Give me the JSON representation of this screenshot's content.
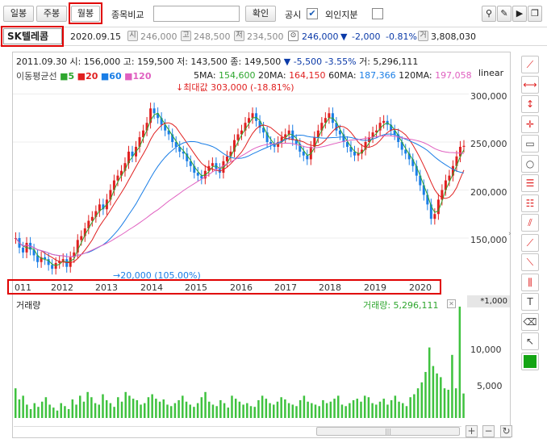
{
  "toolbar": {
    "daily": "일봉",
    "weekly": "주봉",
    "monthly": "월봉",
    "compare_label": "종목비교",
    "compare_value": "",
    "confirm": "확인",
    "notice_label": "공시",
    "foreign_label": "외인지분"
  },
  "stock": {
    "name": "SK텔레콤",
    "date": "2020.09.15",
    "open_icon": "시",
    "open": "246,000",
    "high_icon": "고",
    "high": "248,500",
    "low_icon": "저",
    "low": "234,500",
    "close": "246,000",
    "change_arrow": "▼",
    "change": "-2,000",
    "change_pct": "-0.81%",
    "volume_icon": "거",
    "volume": "3,808,030"
  },
  "info": {
    "line": "2011.09.30 시: 156,000 고: 159,500 저: 143,500 종: 149,500",
    "arrow": "▼",
    "change": "-5,500",
    "pct": "-3.55%",
    "vol": "거: 5,296,111"
  },
  "ma": {
    "title": "이동평균선",
    "p5": "5",
    "p20": "20",
    "p60": "60",
    "p120": "120",
    "v5l": "5MA:",
    "v5": "154,600",
    "v20l": "20MA:",
    "v20": "164,150",
    "v60l": "60MA:",
    "v60": "187,366",
    "v120l": "120MA:",
    "v120": "197,058"
  },
  "scale_mode": "linear",
  "annotations": {
    "max": "최대값 303,000 (-18.81%)",
    "min": "20,000 (105.00%)"
  },
  "chart_data": {
    "type": "candlestick",
    "yticks": [
      "300,000",
      "250,000",
      "200,000",
      "150,000"
    ],
    "years": [
      "011",
      "2012",
      "2013",
      "2014",
      "2015",
      "2016",
      "2017",
      "2018",
      "2019",
      "2020"
    ],
    "volume_label": "거래량",
    "volume_value": "거래량: 5,296,111",
    "volume_unit": "*1,000",
    "volume_ticks": [
      "10,000",
      "5,000"
    ]
  },
  "colors": {
    "up": "#e02020",
    "down": "#1a7ee6",
    "ma5": "#2ea62e",
    "ma20": "#e02020",
    "ma60": "#1a7ee6",
    "ma120": "#e060c0",
    "volume": "#3fc23f",
    "highlight": "#e00000"
  },
  "icons": [
    "line-tool-icon",
    "hline-icon",
    "vline-icon",
    "crosshair-icon",
    "rect-icon",
    "circle-icon",
    "fib-icon",
    "fib2-icon",
    "channel-icon",
    "trend-icon",
    "gann-icon",
    "grid-icon",
    "text-icon",
    "eraser-icon",
    "cursor-icon",
    "color-icon"
  ]
}
